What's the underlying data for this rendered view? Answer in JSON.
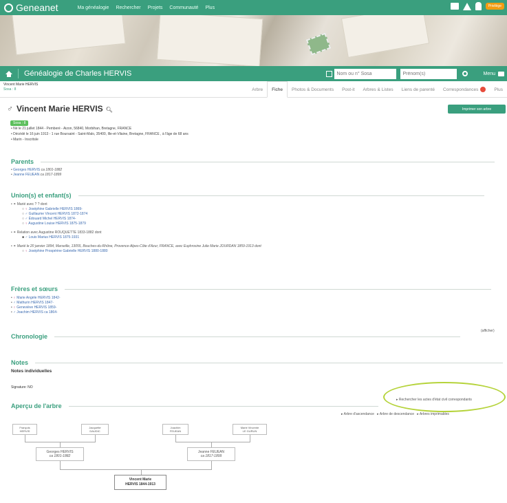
{
  "topnav": {
    "logo": "Geneanet",
    "links": [
      "Ma généalogie",
      "Rechercher",
      "Projets",
      "Communauté",
      "Plus"
    ],
    "badge": "Privilège"
  },
  "tree_bar": {
    "title": "Généalogie de Charles HERVIS",
    "search_placeholder": "Nom ou n° Sosa",
    "firstname_placeholder": "Prénom(s)",
    "menu_label": "Menu"
  },
  "breadcrumb": {
    "name": "Vincent Marie HERVIS",
    "sosa": "Sosa : 8"
  },
  "tabs": [
    "Arbre",
    "Fiche",
    "Photos & Documents",
    "Post-it",
    "Arbres & Listes",
    "Liens de parenté",
    "Correspondances",
    "Plus"
  ],
  "person": {
    "name": "Vincent Marie HERVIS",
    "sosa_badge": "Sosa : 8",
    "facts": [
      "Né le 21 juillet 1844 - Pemberé - Aizon, 56840, Morbihan, Bretagne, FRANCE",
      "Décédé le 16 juin 1913 - 1 rue Boursaint - Saint-Malo, 35400, Ille-et-Vilaine, Bretagne, FRANCE , à l'âge de 68 ans",
      "Marin - Inscritsle"
    ],
    "print_button": "Imprimer son arbre"
  },
  "sections": {
    "parents": "Parents",
    "unions": "Union(s) et enfant(s)",
    "siblings": "Frères et sœurs",
    "chronology": "Chronologie",
    "notes": "Notes",
    "tree_preview": "Aperçu de l'arbre"
  },
  "parents": [
    {
      "name": "Georges HERVIS",
      "dates": "ca 1801-1882"
    },
    {
      "name": "Jeanne FEUEAN",
      "dates": "ca 1817-1899"
    }
  ],
  "unions": {
    "union1": "Marié avec ? ? dont",
    "children1": [
      "Joséphine Gabrielle HERVIS 1869-",
      "Guillaume Vincent HERVIS 1872-1874",
      "Édouard Michel HERVIS 1874-",
      "Augustine Louise HERVIS 1875-1879"
    ],
    "union2": "Relation avec Augustine ROUQUETTE 1833-1882 dont",
    "children2": [
      "Louis Marius HERVIS 1875-1931"
    ],
    "union3": "Marié le 20 janvier 1894, Marseille, 13055, Bouches-du-Rhône, Provence-Alpes-Côte d'Azur, FRANCE, avec Euphrosine Julie Marie JOURDAN 1859-1913 dont",
    "children3": [
      "Joséphine Prospérine Gabrielle HERVIS 1880-1880"
    ]
  },
  "siblings": [
    {
      "sym": "♀",
      "text": "Marie Angèle HERVIS 1842-"
    },
    {
      "sym": "♂",
      "text": "Mathurin HERVIS 1847-"
    },
    {
      "sym": "♀",
      "text": "Geneviève HERVIS 1859-"
    },
    {
      "sym": "♂",
      "text": "Joachim HERVIS ca 1864-"
    }
  ],
  "chronology_toggle": "(afficher)",
  "notes": {
    "sub": "Notes individuelles",
    "signature": "Signature: NO"
  },
  "tree_links": {
    "search_civil": "Rechercher les actes d'état civil correspondants",
    "ascendance": "Arbre d'ascendance",
    "descendance": "Arbre de descendance",
    "printable": "Arbres imprimables"
  },
  "tree": {
    "gp": [
      {
        "line1": "François",
        "line2": "HERVIS"
      },
      {
        "line1": "Jacquette",
        "line2": "DAUDIC"
      },
      {
        "line1": "Joachim",
        "line2": "FEUEAN"
      },
      {
        "line1": "Marie Vincente",
        "line2": "LE GURUN"
      }
    ],
    "parents": [
      {
        "line1": "Georges HERVIS",
        "line2": "ca 1801-1882"
      },
      {
        "line1": "Jeanne FEUEAN",
        "line2": "ca 1817-1899"
      }
    ],
    "self": {
      "line1": "Vincent Marie",
      "line2": "HERVIS 1844-1913"
    }
  }
}
